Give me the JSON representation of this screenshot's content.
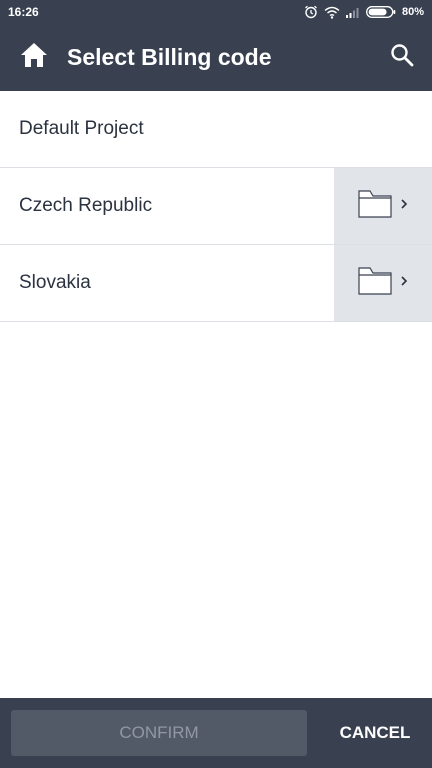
{
  "status_bar": {
    "time": "16:26",
    "battery_percent": "80%",
    "icons": [
      "alarm-icon",
      "wifi-icon",
      "signal-icon",
      "battery-icon"
    ]
  },
  "app_bar": {
    "title": "Select Billing code",
    "left_icon": "home-icon",
    "right_icon": "search-icon"
  },
  "list": {
    "items": [
      {
        "label": "Default Project",
        "has_children": false
      },
      {
        "label": "Czech Republic",
        "has_children": true
      },
      {
        "label": "Slovakia",
        "has_children": true
      }
    ]
  },
  "bottom_bar": {
    "confirm_label": "CONFIRM",
    "confirm_enabled": false,
    "cancel_label": "CANCEL"
  },
  "colors": {
    "header_bg": "#394150",
    "folder_bg": "#e1e4e8",
    "confirm_disabled_bg": "#525a68"
  }
}
